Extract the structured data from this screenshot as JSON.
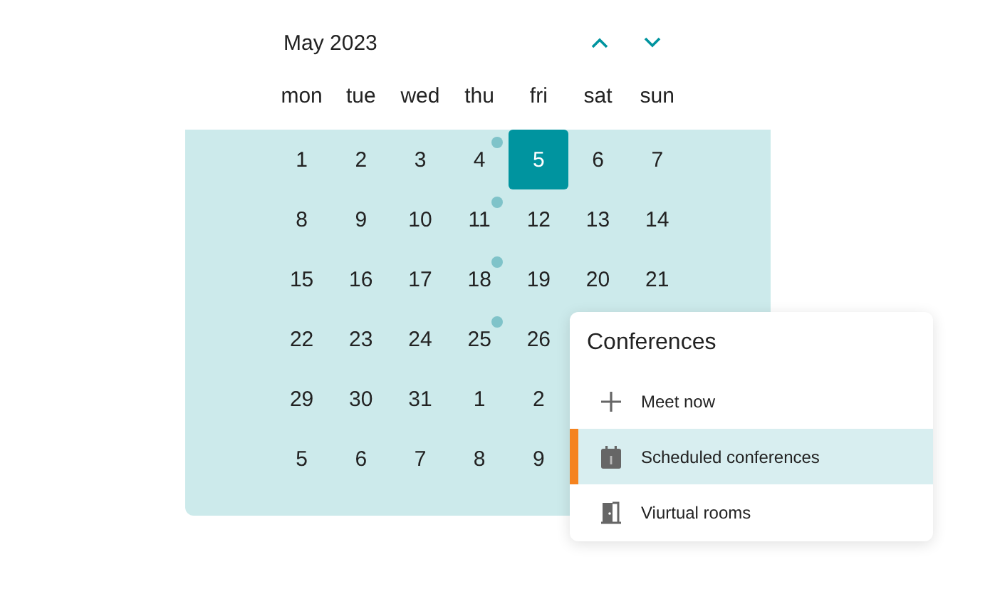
{
  "calendar": {
    "title": "May 2023",
    "weekdays": [
      "mon",
      "tue",
      "wed",
      "thu",
      "fri",
      "sat",
      "sun"
    ],
    "weeks": [
      [
        {
          "label": "1",
          "selected": false,
          "event": false
        },
        {
          "label": "2",
          "selected": false,
          "event": false
        },
        {
          "label": "3",
          "selected": false,
          "event": false
        },
        {
          "label": "4",
          "selected": false,
          "event": true
        },
        {
          "label": "5",
          "selected": true,
          "event": false
        },
        {
          "label": "6",
          "selected": false,
          "event": false
        },
        {
          "label": "7",
          "selected": false,
          "event": false
        }
      ],
      [
        {
          "label": "8",
          "selected": false,
          "event": false
        },
        {
          "label": "9",
          "selected": false,
          "event": false
        },
        {
          "label": "10",
          "selected": false,
          "event": false
        },
        {
          "label": "11",
          "selected": false,
          "event": true
        },
        {
          "label": "12",
          "selected": false,
          "event": false
        },
        {
          "label": "13",
          "selected": false,
          "event": false
        },
        {
          "label": "14",
          "selected": false,
          "event": false
        }
      ],
      [
        {
          "label": "15",
          "selected": false,
          "event": false
        },
        {
          "label": "16",
          "selected": false,
          "event": false
        },
        {
          "label": "17",
          "selected": false,
          "event": false
        },
        {
          "label": "18",
          "selected": false,
          "event": true
        },
        {
          "label": "19",
          "selected": false,
          "event": false
        },
        {
          "label": "20",
          "selected": false,
          "event": false
        },
        {
          "label": "21",
          "selected": false,
          "event": false
        }
      ],
      [
        {
          "label": "22",
          "selected": false,
          "event": false
        },
        {
          "label": "23",
          "selected": false,
          "event": false
        },
        {
          "label": "24",
          "selected": false,
          "event": false
        },
        {
          "label": "25",
          "selected": false,
          "event": true
        },
        {
          "label": "26",
          "selected": false,
          "event": false
        }
      ],
      [
        {
          "label": "29",
          "selected": false,
          "event": false
        },
        {
          "label": "30",
          "selected": false,
          "event": false
        },
        {
          "label": "31",
          "selected": false,
          "event": false
        },
        {
          "label": "1",
          "selected": false,
          "event": false
        },
        {
          "label": "2",
          "selected": false,
          "event": false
        }
      ],
      [
        {
          "label": "5",
          "selected": false,
          "event": false
        },
        {
          "label": "6",
          "selected": false,
          "event": false
        },
        {
          "label": "7",
          "selected": false,
          "event": false
        },
        {
          "label": "8",
          "selected": false,
          "event": false
        },
        {
          "label": "9",
          "selected": false,
          "event": false
        }
      ]
    ]
  },
  "conferences": {
    "title": "Conferences",
    "items": [
      {
        "label": "Meet now",
        "selected": false
      },
      {
        "label": "Scheduled conferences",
        "selected": true
      },
      {
        "label": "Viurtual rooms",
        "selected": false
      }
    ]
  }
}
